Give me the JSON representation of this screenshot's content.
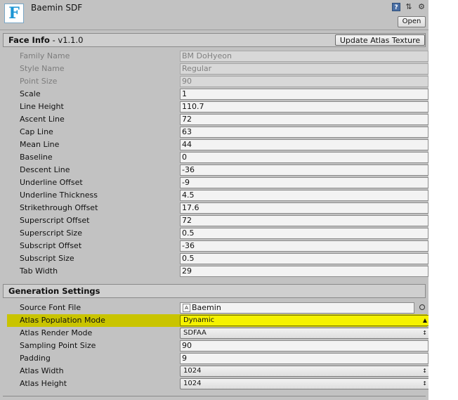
{
  "header": {
    "title": "Baemin SDF",
    "asset_icon_letter": "F",
    "open_button": "Open",
    "icons": [
      "help-icon",
      "preset-icon",
      "gear-icon"
    ]
  },
  "face_info": {
    "title": "Face Info",
    "version": " - v1.1.0",
    "update_button": "Update Atlas Texture",
    "rows": [
      {
        "label": "Family Name",
        "value": "BM DoHyeon",
        "disabled": true
      },
      {
        "label": "Style Name",
        "value": "Regular",
        "disabled": true
      },
      {
        "label": "Point Size",
        "value": "90",
        "disabled": true
      },
      {
        "label": "Scale",
        "value": "1"
      },
      {
        "label": "Line Height",
        "value": "110.7"
      },
      {
        "label": "Ascent Line",
        "value": "72"
      },
      {
        "label": "Cap Line",
        "value": "63"
      },
      {
        "label": "Mean Line",
        "value": "44"
      },
      {
        "label": "Baseline",
        "value": "0"
      },
      {
        "label": "Descent Line",
        "value": "-36"
      },
      {
        "label": "Underline Offset",
        "value": "-9"
      },
      {
        "label": "Underline Thickness",
        "value": "4.5"
      },
      {
        "label": "Strikethrough Offset",
        "value": "17.6"
      },
      {
        "label": "Superscript Offset",
        "value": "72"
      },
      {
        "label": "Superscript Size",
        "value": "0.5"
      },
      {
        "label": "Subscript Offset",
        "value": "-36"
      },
      {
        "label": "Subscript Size",
        "value": "0.5"
      },
      {
        "label": "Tab Width",
        "value": "29"
      }
    ]
  },
  "generation": {
    "title": "Generation Settings",
    "source_font_label": "Source Font File",
    "source_font_value": "Baemin",
    "atlas_population_label": "Atlas Population Mode",
    "atlas_population_value": "Dynamic",
    "atlas_render_label": "Atlas Render Mode",
    "atlas_render_value": "SDFAA",
    "sampling_label": "Sampling Point Size",
    "sampling_value": "90",
    "padding_label": "Padding",
    "padding_value": "9",
    "atlas_width_label": "Atlas Width",
    "atlas_width_value": "1024",
    "atlas_height_label": "Atlas Height",
    "atlas_height_value": "1024",
    "highlight_color": "#c9c400"
  }
}
